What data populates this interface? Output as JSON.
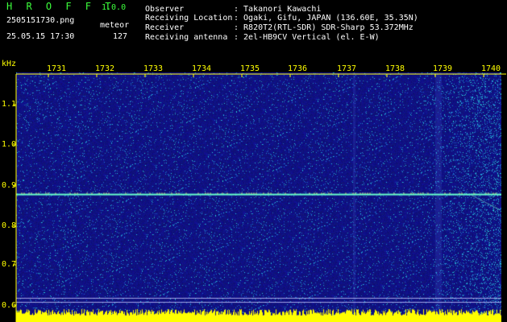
{
  "header": {
    "app_name": "H R O F F T",
    "version": "1.0.0",
    "file_name": "2505151730.png",
    "meteor_label": "meteor",
    "datetime": "25.05.15 17:30",
    "meteor_count": "127",
    "info": [
      {
        "key": "Observer",
        "value": ": Takanori Kawachi"
      },
      {
        "key": "Receiving Location",
        "value": ": Ogaki, Gifu, JAPAN (136.60E, 35.35N)"
      },
      {
        "key": "Receiver",
        "value": ": R820T2(RTL-SDR) SDR-Sharp 53.372MHz"
      },
      {
        "key": "Receiving antenna",
        "value": ": 2el-HB9CV Vertical (el. E-W)"
      }
    ]
  },
  "spectrogram": {
    "y_unit": "kHz",
    "y_ticks": [
      "1.1",
      "1.0",
      "0.9",
      "0.8",
      "0.7",
      "0.6"
    ],
    "x_ticks": [
      "1731",
      "1732",
      "1733",
      "1734",
      "1735",
      "1736",
      "1737",
      "1738",
      "1739",
      "1740"
    ],
    "carrier_khz": 0.88,
    "colors": {
      "background": "#14148c",
      "carrier": "#66ffcc",
      "axis_text": "#ffff00",
      "baseline_fill": "#ffff00"
    }
  }
}
